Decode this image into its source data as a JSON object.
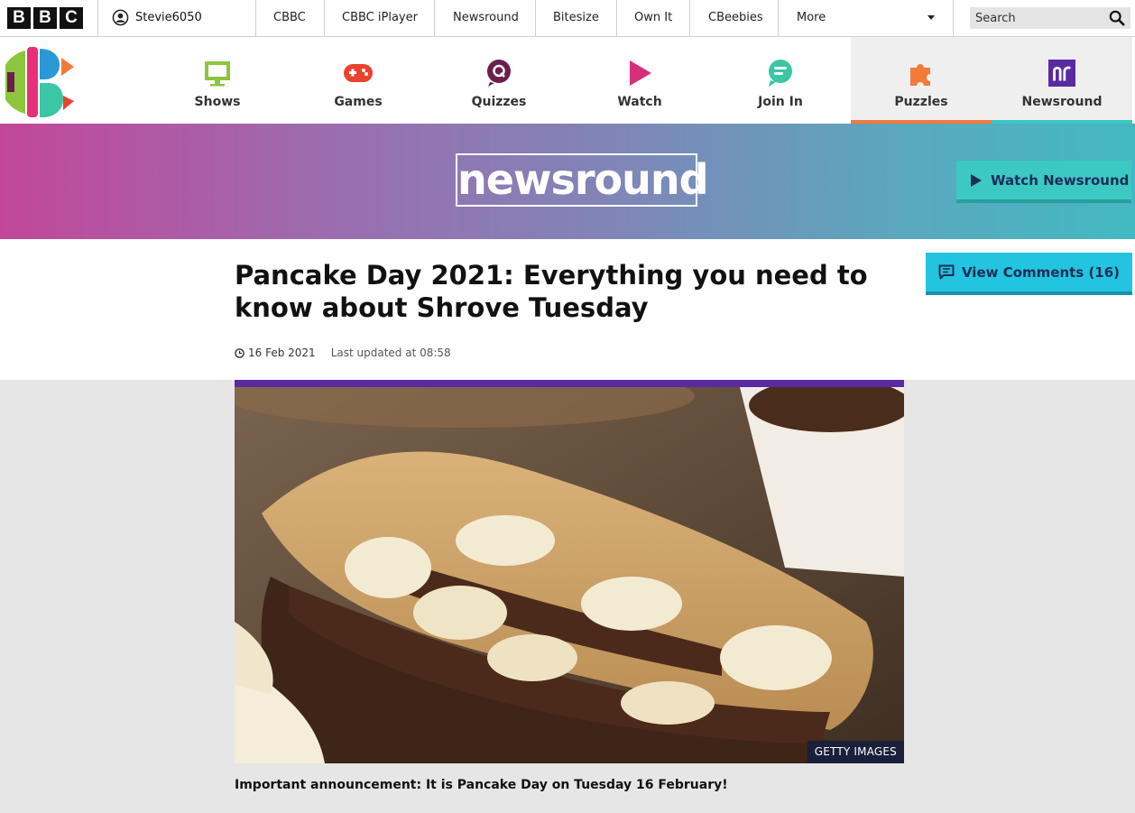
{
  "global_bar": {
    "logo_letters": [
      "B",
      "B",
      "C"
    ],
    "account_name": "Stevie6050",
    "links": [
      "CBBC",
      "CBBC iPlayer",
      "Newsround",
      "Bitesize",
      "Own It",
      "CBeebies",
      "More"
    ],
    "search_placeholder": "Search"
  },
  "cbbc_nav": {
    "tabs": [
      {
        "label": "Shows",
        "icon": "tv-icon",
        "color": "#8cc63f"
      },
      {
        "label": "Games",
        "icon": "gamepad-icon",
        "color": "#e8432e"
      },
      {
        "label": "Quizzes",
        "icon": "quiz-icon",
        "color": "#6b1f4d"
      },
      {
        "label": "Watch",
        "icon": "play-icon",
        "color": "#d6307a"
      },
      {
        "label": "Join In",
        "icon": "chat-icon",
        "color": "#3bc6a6"
      },
      {
        "label": "Puzzles",
        "icon": "puzzle-icon",
        "color": "#f27b3a",
        "active": true
      },
      {
        "label": "Newsround",
        "icon": "newsround-icon",
        "color": "#5a2aa0"
      }
    ]
  },
  "banner": {
    "logo_text": "newsround",
    "watch_label": "Watch Newsround",
    "colors": {
      "start": "#c2479a",
      "end": "#42b9c2",
      "button": "#3cc9c4"
    }
  },
  "article": {
    "headline": "Pancake Day 2021: Everything you need to know about Shrove Tuesday",
    "date": "16 Feb 2021",
    "updated": "Last updated at 08:58",
    "comments_label": "View Comments (16)",
    "image_credit": "GETTY IMAGES",
    "caption": "Important announcement: It is Pancake Day on Tuesday 16 February!"
  }
}
